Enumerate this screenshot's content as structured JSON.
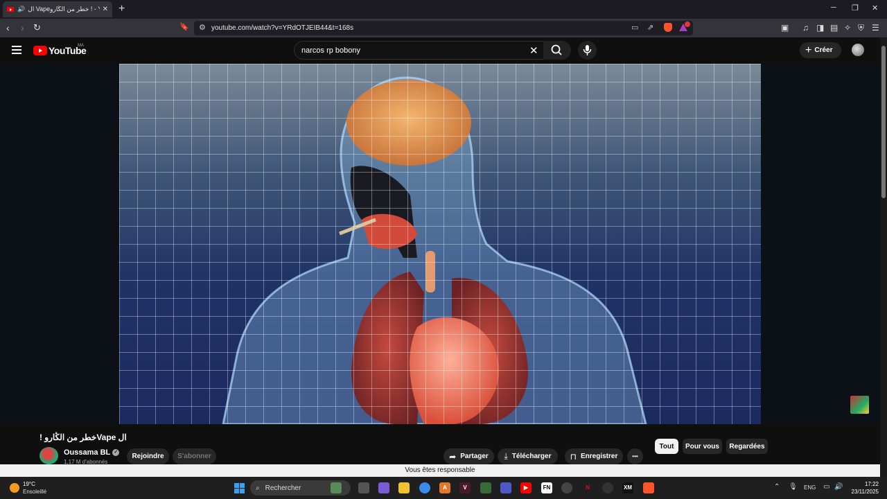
{
  "browser": {
    "tab_title": "ال Vapeخطر من الڭارو ! - YouTube",
    "url": "youtube.com/watch?v=YRdOTJEIB44&t=168s",
    "new_tab": "+"
  },
  "youtube": {
    "logo_text": "YouTube",
    "country_code": "MA",
    "search_value": "narcos rp bobony",
    "create_label": "Créer"
  },
  "video": {
    "title": "ال Vapeخطر من الڭارو !",
    "channel_name": "Oussama BL",
    "subscribers": "1,17 M d'abonnés",
    "join_label": "Rejoindre",
    "subscribe_label": "S'abonner",
    "share_label": "Partager",
    "download_label": "Télécharger",
    "save_label": "Enregistrer",
    "more_label": "•••"
  },
  "chips": [
    "Tout",
    "Pour vous",
    "Regardées"
  ],
  "notice": "Vous êtes responsable",
  "taskbar": {
    "temperature": "19°C",
    "weather": "Ensoleillé",
    "search_label": "Rechercher",
    "language": "ENG",
    "time": "17:22",
    "date": "23/11/2025"
  }
}
